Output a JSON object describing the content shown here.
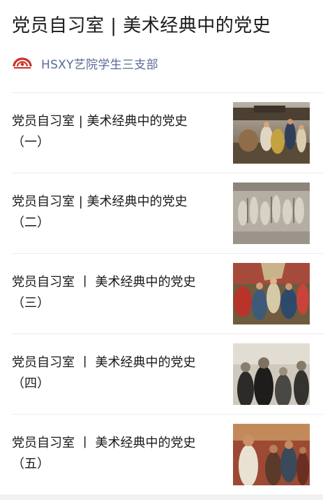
{
  "header": {
    "title": "党员自习室 | 美术经典中的党史"
  },
  "account": {
    "name": "HSXY艺院学生三支部",
    "logo_icon": "school-logo-icon",
    "accent_color": "#576b95"
  },
  "articles": [
    {
      "title": "党员自习室 | 美术经典中的党史\n（一）",
      "thumbnail_icon": "painting-crowd-thumbnail"
    },
    {
      "title": "党员自习室 | 美术经典中的党史\n（二）",
      "thumbnail_icon": "stone-relief-thumbnail"
    },
    {
      "title": "党员自习室 丨 美术经典中的党史\n（三）",
      "thumbnail_icon": "painting-rally-thumbnail"
    },
    {
      "title": "党员自习室 丨 美术经典中的党史\n（四）",
      "thumbnail_icon": "portrait-group-thumbnail"
    },
    {
      "title": "党员自习室 丨 美术经典中的党史\n（五）",
      "thumbnail_icon": "painting-figures-thumbnail"
    }
  ]
}
